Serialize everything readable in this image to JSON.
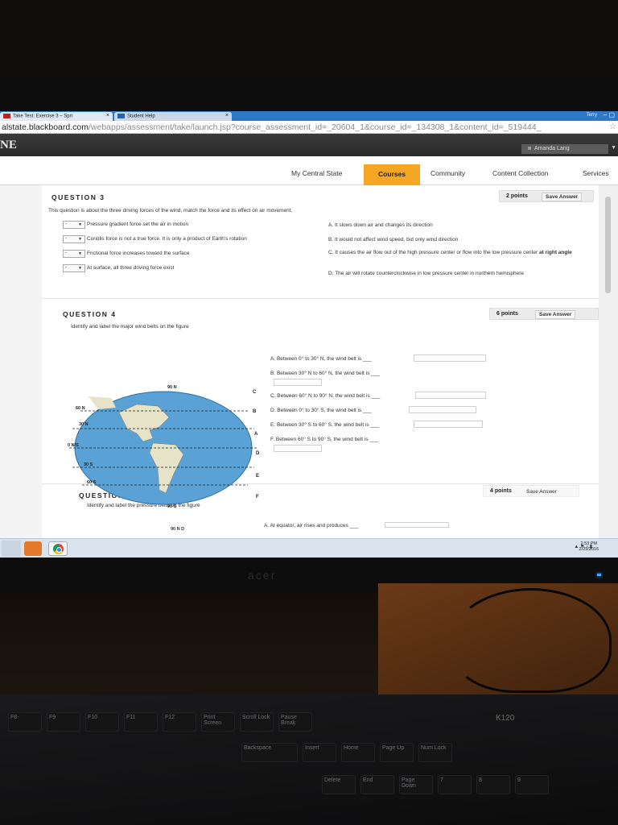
{
  "browser": {
    "tabs": [
      {
        "label": "Take Test: Exercise 3 – Spri",
        "icon": "blackboard-tab-icon"
      },
      {
        "label": "Student Help",
        "icon": "student-help-tab-icon"
      }
    ],
    "window_user": "Terry",
    "window_controls": "–  ▢",
    "url_host": "alstate.blackboard.com",
    "url_path": "/webapps/assessment/take/launch.jsp?course_assessment_id=_20604_1&course_id=_134308_1&content_id=_519444_"
  },
  "header": {
    "logo_text": "NE",
    "user_name": "Amanda Lang"
  },
  "nav": {
    "tabs": [
      "My Central State",
      "Courses",
      "Community",
      "Content Collection",
      "Services"
    ],
    "active": "Courses"
  },
  "question3": {
    "title": "QUESTION 3",
    "points": "2 points",
    "save": "Save Answer",
    "prompt": "This question is about the three driving forces of the wind, match the force and its effect on air movement.",
    "items": [
      "Pressure gradient force set the air in motion",
      "Coriolis force is not a true force. It is only a product of Earth's rotation",
      "Frictional force increases toward the surface",
      "At surface, all three driving force exist"
    ],
    "select_value": "-",
    "options": [
      "A. It slows down air and changes its direction",
      "B. It would not affect wind speed, but only wind direction",
      "C. It causes the air flow out of the high pressure center or flow into the low pressure center",
      "at right angle",
      "D. The air will rotate counterclockwise in low pressure center in northern hemisphere"
    ]
  },
  "question4": {
    "title": "QUESTION 4",
    "points": "6 points",
    "save": "Save Answer",
    "prompt": "Identify and label the major wind belts on the figure",
    "map_labels": {
      "n90": "90 N",
      "n60": "60 N",
      "n30": "30 N",
      "eq": "0 N/S",
      "s30": "30 S",
      "s60": "60 S",
      "s90": "90 S"
    },
    "letters": [
      "C",
      "B",
      "A",
      "D",
      "E",
      "F"
    ],
    "blanks": [
      "A. Between 0° to 30° N, the wind belt is ___",
      "B. Between 30° N to 60° N, the wind belt is ___",
      "C. Between 60° N to 90° N, the wind belt is ___",
      "D. Between 0° to 30° S, the wind belt is ___",
      "E. Between 30° S to 60° S, the wind belt is ___",
      "F. Between 60° S to 90° S, the wind belt is ___"
    ]
  },
  "question5": {
    "title": "QUESTION 5",
    "points": "4 points",
    "save": "Save Answer",
    "prompt": "Identify and label the pressure belts on the figure",
    "map_label": "90 N D",
    "blank": "A. At equator, air rises and produces ___"
  },
  "taskbar": {
    "time": "2:53 PM",
    "date": "2/29/2016"
  },
  "hardware": {
    "monitor_brand": "acer",
    "keyboard_model": "K120",
    "keys": [
      "F8",
      "F9",
      "F10",
      "F11",
      "F12",
      "Print Screen",
      "Scroll Lock",
      "Pause Break",
      "Backspace",
      "Insert",
      "Home",
      "Page Up",
      "Num Lock",
      "Delete",
      "End",
      "Page Down",
      "7",
      "8",
      "9"
    ]
  },
  "colors": {
    "courses_tab": "#f5a623",
    "taskbar": "#d9e3ee",
    "tab_strip": "#2d78c8"
  }
}
